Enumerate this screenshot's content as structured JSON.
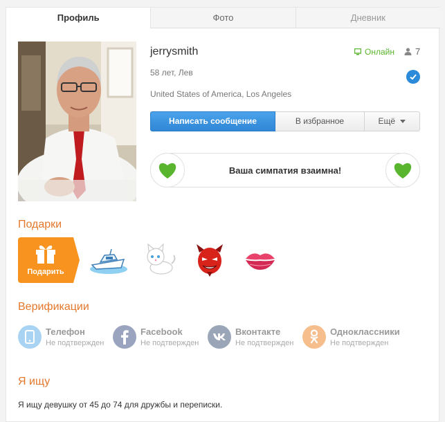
{
  "tabs": [
    {
      "label": "Профиль"
    },
    {
      "label": "Фото"
    },
    {
      "label": "Дневник"
    }
  ],
  "profile": {
    "username": "jerrysmith",
    "status": "Онлайн",
    "friends_count": "7",
    "age_sign": "58 лет, Лев",
    "location": "United States of America, Los Angeles"
  },
  "actions": {
    "message": "Написать сообщение",
    "favorite": "В избранное",
    "more": "Ещё"
  },
  "mutual": {
    "text": "Ваша симпатия взаимна!"
  },
  "gifts": {
    "title": "Подарки",
    "button": "Подарить",
    "items": [
      "boat-gift-icon",
      "kitten-gift-icon",
      "devil-gift-icon",
      "lips-gift-icon"
    ]
  },
  "verification": {
    "title": "Верификации",
    "items": [
      {
        "name": "Телефон",
        "status": "Не подтвержден",
        "icon": "phone-icon",
        "color": "#a9d3f2"
      },
      {
        "name": "Facebook",
        "status": "Не подтвержден",
        "icon": "facebook-icon",
        "color": "#9aa4be"
      },
      {
        "name": "Вконтакте",
        "status": "Не подтвержден",
        "icon": "vk-icon",
        "color": "#9aa6b8"
      },
      {
        "name": "Одноклассники",
        "status": "Не подтвержден",
        "icon": "odnoklassniki-icon",
        "color": "#f6be8c"
      }
    ]
  },
  "seeking": {
    "title": "Я ищу",
    "text": "Я ищу девушку от 45 до 74 для дружбы и переписки."
  },
  "colors": {
    "accent": "#e4772c",
    "online": "#5ab52e",
    "primary": "#2f86d6",
    "heart": "#5ab52e",
    "gift_button": "#f7931e"
  }
}
